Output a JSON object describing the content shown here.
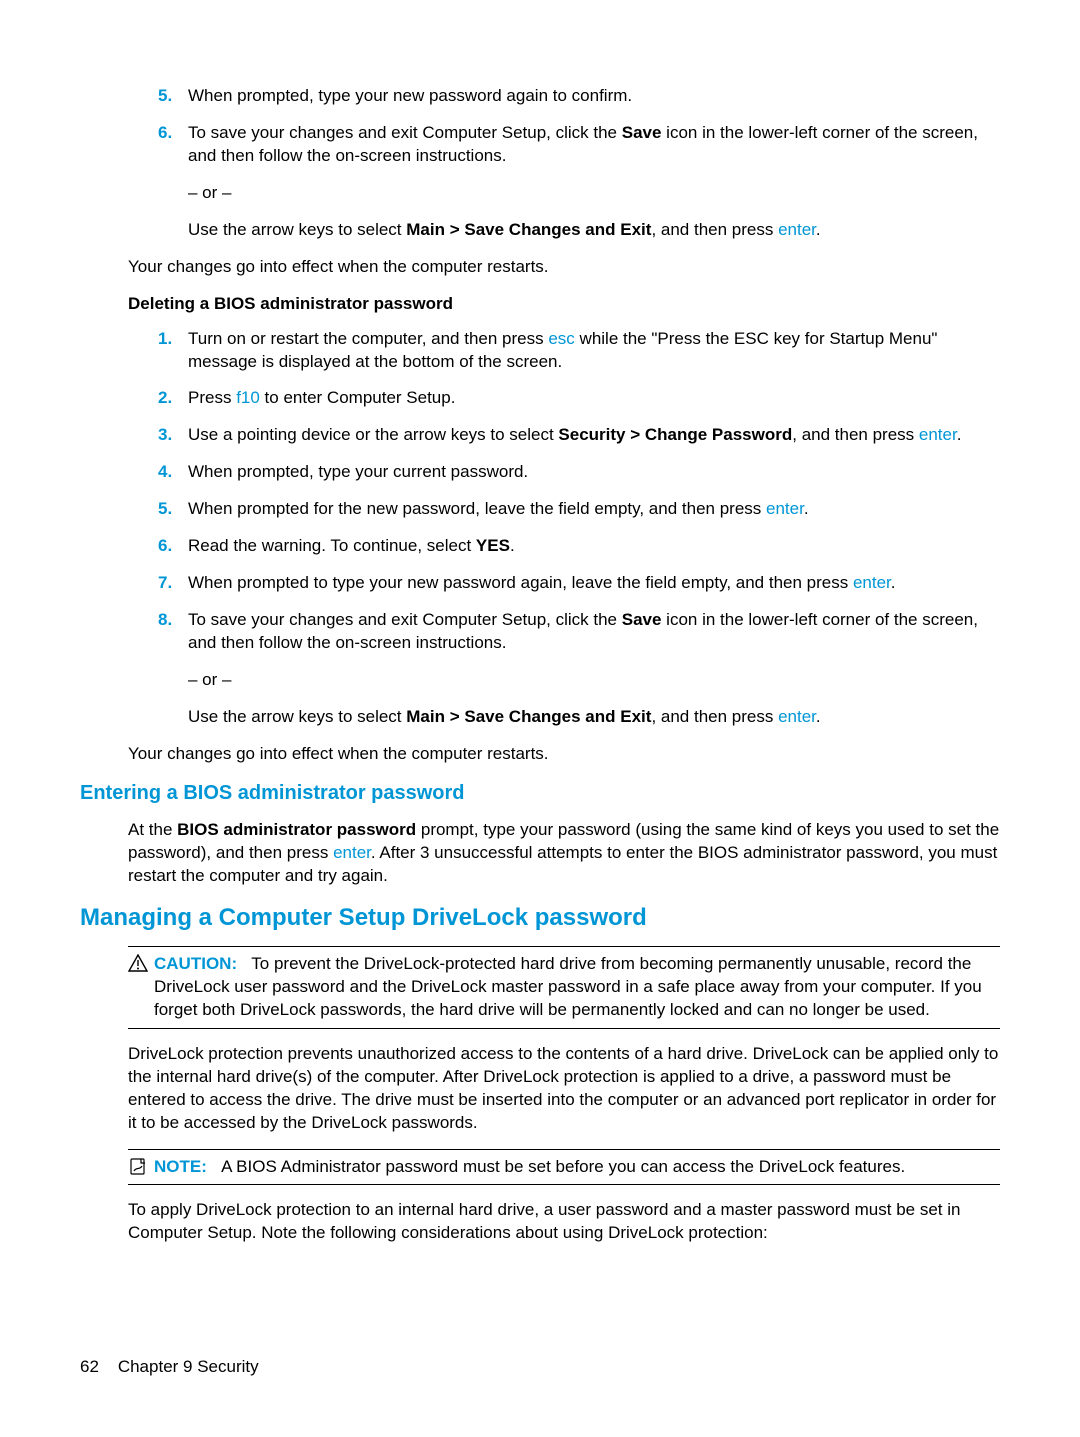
{
  "steps_top": {
    "s5": {
      "num": "5.",
      "text": "When prompted, type your new password again to confirm."
    },
    "s6": {
      "num": "6.",
      "text_pre": "To save your changes and exit Computer Setup, click the ",
      "save_bold": "Save",
      "text_post": " icon in the lower-left corner of the screen, and then follow the on-screen instructions.",
      "or": "– or –",
      "alt_pre": "Use the arrow keys to select ",
      "alt_bold": "Main > Save Changes and Exit",
      "alt_mid": ", and then press ",
      "alt_key": "enter",
      "alt_end": "."
    },
    "effect": "Your changes go into effect when the computer restarts."
  },
  "delete_heading": "Deleting a BIOS administrator password",
  "delete_steps": {
    "s1": {
      "num": "1.",
      "pre": "Turn on or restart the computer, and then press ",
      "key": "esc",
      "post": " while the \"Press the ESC key for Startup Menu\" message is displayed at the bottom of the screen."
    },
    "s2": {
      "num": "2.",
      "pre": "Press ",
      "key": "f10",
      "post": " to enter Computer Setup."
    },
    "s3": {
      "num": "3.",
      "pre": "Use a pointing device or the arrow keys to select ",
      "bold": "Security > Change Password",
      "mid": ", and then press ",
      "key": "enter",
      "end": "."
    },
    "s4": {
      "num": "4.",
      "text": "When prompted, type your current password."
    },
    "s5": {
      "num": "5.",
      "pre": "When prompted for the new password, leave the field empty, and then press ",
      "key": "enter",
      "end": "."
    },
    "s6": {
      "num": "6.",
      "pre": "Read the warning. To continue, select ",
      "bold": "YES",
      "end": "."
    },
    "s7": {
      "num": "7.",
      "pre": "When prompted to type your new password again, leave the field empty, and then press ",
      "key": "enter",
      "end": "."
    },
    "s8": {
      "num": "8.",
      "text_pre": "To save your changes and exit Computer Setup, click the ",
      "save_bold": "Save",
      "text_post": " icon in the lower-left corner of the screen, and then follow the on-screen instructions.",
      "or": "– or –",
      "alt_pre": "Use the arrow keys to select ",
      "alt_bold": "Main > Save Changes and Exit",
      "alt_mid": ", and then press ",
      "alt_key": "enter",
      "alt_end": "."
    },
    "effect": "Your changes go into effect when the computer restarts."
  },
  "entering_heading": "Entering a BIOS administrator password",
  "entering_para": {
    "pre": "At the ",
    "bold": "BIOS administrator password",
    "mid": " prompt, type your password (using the same kind of keys you used to set the password), and then press ",
    "key": "enter",
    "post": ". After 3 unsuccessful attempts to enter the BIOS administrator password, you must restart the computer and try again."
  },
  "drivelock_heading": "Managing a Computer Setup DriveLock password",
  "caution": {
    "label": "CAUTION:",
    "text": "To prevent the DriveLock-protected hard drive from becoming permanently unusable, record the DriveLock user password and the DriveLock master password in a safe place away from your computer. If you forget both DriveLock passwords, the hard drive will be permanently locked and can no longer be used."
  },
  "drivelock_para1": "DriveLock protection prevents unauthorized access to the contents of a hard drive. DriveLock can be applied only to the internal hard drive(s) of the computer. After DriveLock protection is applied to a drive, a password must be entered to access the drive. The drive must be inserted into the computer or an advanced port replicator in order for it to be accessed by the DriveLock passwords.",
  "note": {
    "label": "NOTE:",
    "text": "A BIOS Administrator password must be set before you can access the DriveLock features."
  },
  "drivelock_para2": "To apply DriveLock protection to an internal hard drive, a user password and a master password must be set in Computer Setup. Note the following considerations about using DriveLock protection:",
  "footer": {
    "page": "62",
    "chapter": "Chapter 9   Security"
  }
}
